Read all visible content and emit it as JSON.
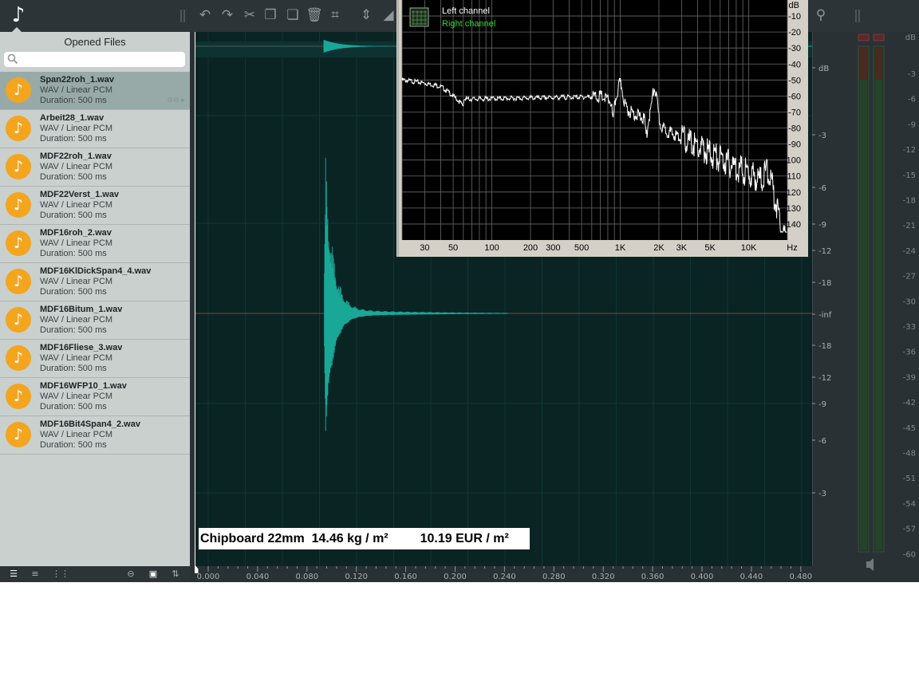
{
  "sidebar": {
    "title": "Opened Files",
    "search_placeholder": "",
    "files": [
      {
        "name": "Span22roh_1.wav",
        "type": "WAV / Linear PCM",
        "duration": "Duration: 500 ms",
        "selected": true
      },
      {
        "name": "Arbeit28_1.wav",
        "type": "WAV / Linear PCM",
        "duration": "Duration: 500 ms"
      },
      {
        "name": "MDF22roh_1.wav",
        "type": "WAV / Linear PCM",
        "duration": "Duration: 500 ms"
      },
      {
        "name": "MDF22Verst_1.wav",
        "type": "WAV / Linear PCM",
        "duration": "Duration: 500 ms"
      },
      {
        "name": "MDF16roh_2.wav",
        "type": "WAV / Linear PCM",
        "duration": "Duration: 500 ms"
      },
      {
        "name": "MDF16KlDickSpan4_4.wav",
        "type": "WAV / Linear PCM",
        "duration": "Duration: 500 ms"
      },
      {
        "name": "MDF16Bitum_1.wav",
        "type": "WAV / Linear PCM",
        "duration": "Duration: 500 ms"
      },
      {
        "name": "MDF16Fliese_3.wav",
        "type": "WAV / Linear PCM",
        "duration": "Duration: 500 ms"
      },
      {
        "name": "MDF16WFP10_1.wav",
        "type": "WAV / Linear PCM",
        "duration": "Duration: 500 ms"
      },
      {
        "name": "MDF16Bit4Span4_2.wav",
        "type": "WAV / Linear PCM",
        "duration": "Duration: 500 ms"
      }
    ]
  },
  "caption": "Chipboard 22mm  14.46 kg / m²         10.19 EUR / m²",
  "spectrum": {
    "legend_left": "Left channel",
    "legend_right": "Right channel",
    "y_unit": "dB",
    "x_unit": "Hz",
    "y_ticks": [
      "-10",
      "-20",
      "-30",
      "-40",
      "-50",
      "-60",
      "-70",
      "-80",
      "-90",
      "-100",
      "-110",
      "-120",
      "-130",
      "-140"
    ],
    "x_ticks": [
      {
        "label": "30",
        "f": 30
      },
      {
        "label": "50",
        "f": 50
      },
      {
        "label": "100",
        "f": 100
      },
      {
        "label": "200",
        "f": 200
      },
      {
        "label": "300",
        "f": 300
      },
      {
        "label": "500",
        "f": 500
      },
      {
        "label": "1K",
        "f": 1000
      },
      {
        "label": "2K",
        "f": 2000
      },
      {
        "label": "3K",
        "f": 3000
      },
      {
        "label": "5K",
        "f": 5000
      },
      {
        "label": "10K",
        "f": 10000
      }
    ]
  },
  "db_scale": {
    "unit": "dB",
    "upper_labels": [
      "-3",
      "-6",
      "-9",
      "-12",
      "-18"
    ],
    "center_label": "-inf",
    "lower_labels": [
      "-18",
      "-12",
      "-9",
      "-6",
      "-3"
    ]
  },
  "time_ruler": {
    "labels": [
      "0.000",
      "0.040",
      "0.080",
      "0.120",
      "0.160",
      "0.200",
      "0.240",
      "0.280",
      "0.320",
      "0.360",
      "0.400",
      "0.440",
      "0.480"
    ]
  },
  "meter": {
    "unit": "dB",
    "labels": [
      "-3",
      "-6",
      "-9",
      "-12",
      "-15",
      "-18",
      "-21",
      "-24",
      "-27",
      "-30",
      "-33",
      "-36",
      "-39",
      "-42",
      "-45",
      "-48",
      "-51",
      "-54",
      "-57",
      "-60"
    ]
  },
  "colors": {
    "waveform": "#19a898",
    "file_icon": "#f4a51e",
    "right_channel": "#35d635"
  }
}
